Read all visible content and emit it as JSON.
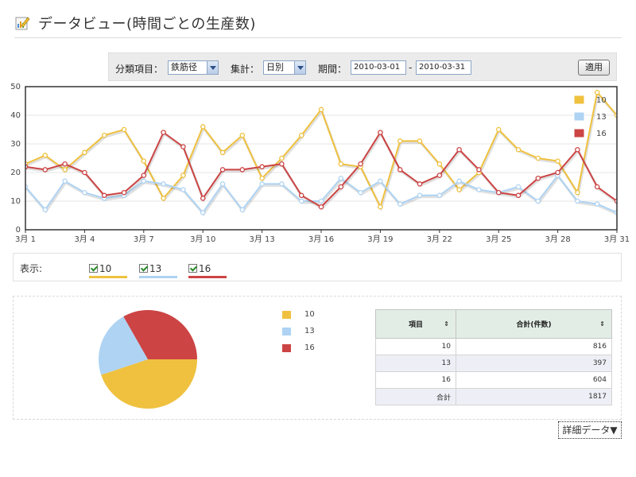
{
  "header": {
    "title": "データビュー(時間ごとの生産数)",
    "icon": "chart-icon"
  },
  "filters": {
    "category_label": "分類項目：",
    "category_value": "鉄筋径",
    "aggregate_label": "集計：",
    "aggregate_value": "日別",
    "period_label": "期間：",
    "date_from": "2010-03-01",
    "date_separator": "-",
    "date_to": "2010-03-31",
    "apply_label": "適用"
  },
  "colors": {
    "s10": "#efc13f",
    "s13": "#aed3f3",
    "s16": "#cc4444"
  },
  "chart_data": [
    {
      "type": "line",
      "x": [
        1,
        2,
        3,
        4,
        5,
        6,
        7,
        8,
        9,
        10,
        11,
        12,
        13,
        14,
        15,
        16,
        17,
        18,
        19,
        20,
        21,
        22,
        23,
        24,
        25,
        26,
        27,
        28,
        29,
        30,
        31
      ],
      "xticks": [
        {
          "x": 1,
          "label": "3月 1"
        },
        {
          "x": 4,
          "label": "3月 4"
        },
        {
          "x": 7,
          "label": "3月 7"
        },
        {
          "x": 10,
          "label": "3月 10"
        },
        {
          "x": 13,
          "label": "3月 13"
        },
        {
          "x": 16,
          "label": "3月 16"
        },
        {
          "x": 19,
          "label": "3月 19"
        },
        {
          "x": 22,
          "label": "3月 22"
        },
        {
          "x": 25,
          "label": "3月 25"
        },
        {
          "x": 28,
          "label": "3月 28"
        },
        {
          "x": 31,
          "label": "3月 31"
        }
      ],
      "yticks": [
        0,
        10,
        20,
        30,
        40,
        50
      ],
      "ylim": [
        0,
        50
      ],
      "xlim": [
        1,
        31
      ],
      "grid": true,
      "legend_position": "top-right",
      "series": [
        {
          "name": "10",
          "color": "#efc13f",
          "values": [
            23,
            26,
            21,
            27,
            33,
            35,
            24,
            11,
            19,
            36,
            27,
            33,
            18,
            25,
            33,
            42,
            23,
            22,
            8,
            31,
            31,
            23,
            14,
            20,
            35,
            28,
            25,
            24,
            13,
            48,
            40
          ]
        },
        {
          "name": "13",
          "color": "#aed3f3",
          "values": [
            15,
            7,
            17,
            13,
            11,
            12,
            17,
            16,
            14,
            6,
            16,
            7,
            16,
            16,
            10,
            10,
            18,
            13,
            17,
            9,
            12,
            12,
            17,
            14,
            13,
            15,
            10,
            19,
            10,
            9,
            6
          ]
        },
        {
          "name": "16",
          "color": "#cc4444",
          "values": [
            22,
            21,
            23,
            20,
            12,
            13,
            19,
            34,
            29,
            11,
            21,
            21,
            22,
            23,
            12,
            8,
            15,
            23,
            34,
            21,
            16,
            19,
            28,
            21,
            13,
            12,
            18,
            20,
            28,
            15,
            10
          ]
        }
      ]
    },
    {
      "type": "pie",
      "slices": [
        {
          "name": "10",
          "value": 816,
          "color": "#efc13f"
        },
        {
          "name": "13",
          "value": 397,
          "color": "#aed3f3"
        },
        {
          "name": "16",
          "value": 604,
          "color": "#cc4444"
        }
      ]
    }
  ],
  "display": {
    "label": "表示:",
    "toggles": [
      {
        "label": "10",
        "checked": true,
        "color": "#efc13f"
      },
      {
        "label": "13",
        "checked": true,
        "color": "#aed3f3"
      },
      {
        "label": "16",
        "checked": true,
        "color": "#cc4444"
      }
    ]
  },
  "pie_legend": [
    {
      "label": "10",
      "color": "#efc13f"
    },
    {
      "label": "13",
      "color": "#aed3f3"
    },
    {
      "label": "16",
      "color": "#cc4444"
    }
  ],
  "table": {
    "headers": [
      "項目",
      "合計(件数)"
    ],
    "sort_icon": "⇕",
    "rows": [
      {
        "item": "10",
        "total": "816"
      },
      {
        "item": "13",
        "total": "397"
      },
      {
        "item": "16",
        "total": "604"
      },
      {
        "item": "合計",
        "total": "1817"
      }
    ]
  },
  "detail_button": "詳細データ▼"
}
